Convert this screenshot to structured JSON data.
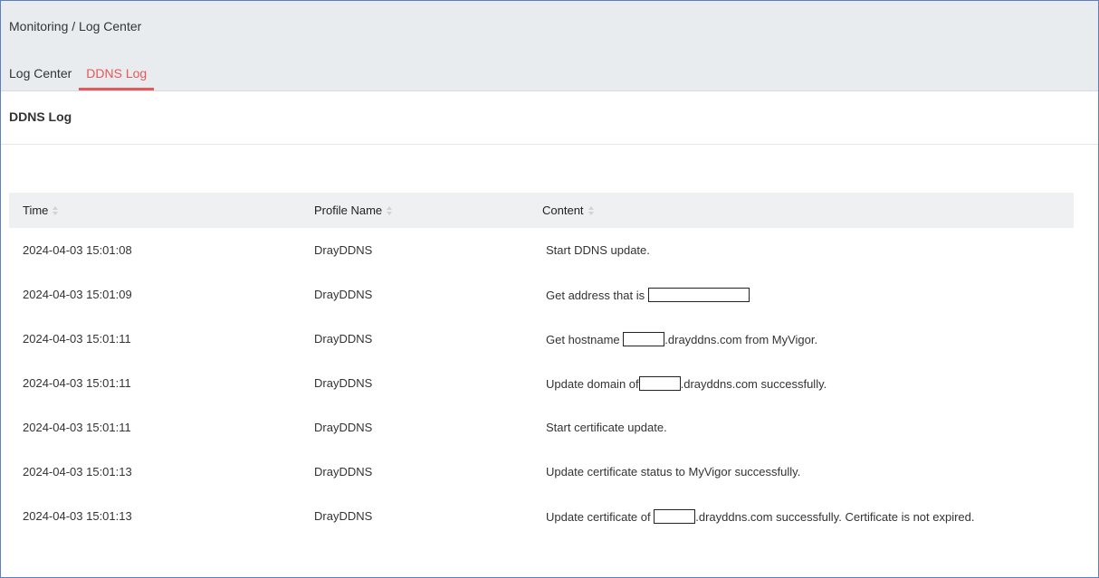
{
  "breadcrumb": "Monitoring / Log Center",
  "tabs": [
    {
      "label": "Log Center",
      "active": false
    },
    {
      "label": "DDNS Log",
      "active": true
    }
  ],
  "panel_title": "DDNS Log",
  "table": {
    "columns": [
      "Time",
      "Profile Name",
      "Content"
    ],
    "rows": [
      {
        "time": "2024-04-03 15:01:08",
        "profile": "DrayDDNS",
        "content_before": "Start DDNS update.",
        "content_after": ""
      },
      {
        "time": "2024-04-03 15:01:09",
        "profile": "DrayDDNS",
        "content_before": "Get address that is ",
        "content_after": ""
      },
      {
        "time": "2024-04-03 15:01:11",
        "profile": "DrayDDNS",
        "content_before": "Get hostname ",
        "content_after": ".drayddns.com from MyVigor."
      },
      {
        "time": "2024-04-03 15:01:11",
        "profile": "DrayDDNS",
        "content_before": "Update domain of",
        "content_after": ".drayddns.com successfully."
      },
      {
        "time": "2024-04-03 15:01:11",
        "profile": "DrayDDNS",
        "content_before": "Start certificate update.",
        "content_after": ""
      },
      {
        "time": "2024-04-03 15:01:13",
        "profile": "DrayDDNS",
        "content_before": "Update certificate status to MyVigor successfully.",
        "content_after": ""
      },
      {
        "time": "2024-04-03 15:01:13",
        "profile": "DrayDDNS",
        "content_before": "Update certificate of ",
        "content_after": ".drayddns.com successfully. Certificate is not expired."
      }
    ]
  },
  "colors": {
    "accent": "#e8565a",
    "header_bg": "#e9ecef",
    "table_header_bg": "#eef0f2"
  }
}
